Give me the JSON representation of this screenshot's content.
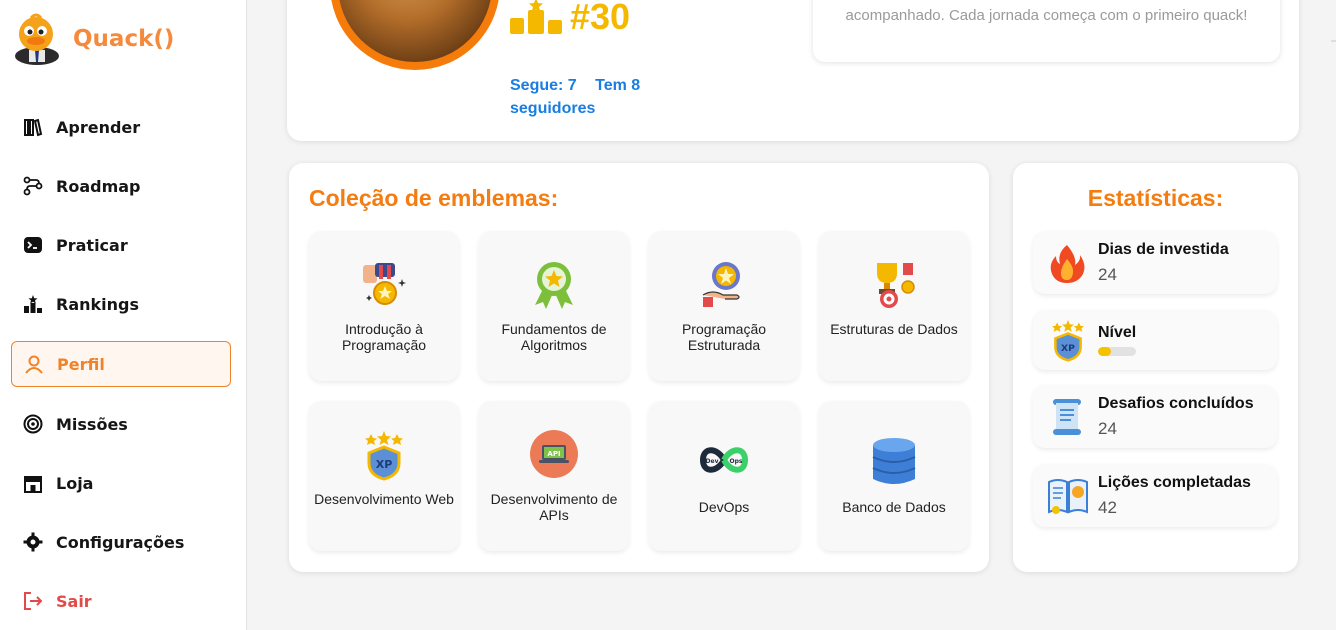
{
  "brand": {
    "name": "Quack()"
  },
  "nav": [
    {
      "label": "Aprender",
      "icon": "books-icon"
    },
    {
      "label": "Roadmap",
      "icon": "roadmap-icon"
    },
    {
      "label": "Praticar",
      "icon": "terminal-icon"
    },
    {
      "label": "Rankings",
      "icon": "podium-icon"
    },
    {
      "label": "Perfil",
      "icon": "user-icon",
      "active": true
    },
    {
      "label": "Missões",
      "icon": "target-icon"
    },
    {
      "label": "Loja",
      "icon": "store-icon"
    },
    {
      "label": "Configurações",
      "icon": "gear-icon"
    },
    {
      "label": "Sair",
      "icon": "logout-icon"
    }
  ],
  "profile": {
    "rank": "#30",
    "following": "Segue: 7",
    "followers": "Tem 8 seguidores",
    "quote": "acompanhado. Cada jornada começa com o primeiro quack!"
  },
  "badges": {
    "title": "Coleção de emblemas:",
    "items": [
      {
        "label": "Introdução à Programação",
        "icon": "medal-hand-icon"
      },
      {
        "label": "Fundamentos de Algoritmos",
        "icon": "rosette-star-icon"
      },
      {
        "label": "Programação Estruturada",
        "icon": "star-hand-icon"
      },
      {
        "label": "Estruturas de Dados",
        "icon": "trophy-target-icon"
      },
      {
        "label": "Desenvolvimento Web",
        "icon": "xp-shield-icon"
      },
      {
        "label": "Desenvolvimento de APIs",
        "icon": "api-laptop-icon"
      },
      {
        "label": "DevOps",
        "icon": "devops-infinity-icon"
      },
      {
        "label": "Banco de Dados",
        "icon": "database-icon"
      }
    ]
  },
  "stats": {
    "title": "Estatísticas:",
    "days": {
      "label": "Dias de investida",
      "value": "24",
      "icon": "fire-icon"
    },
    "level": {
      "label": "Nível",
      "progress": 0.35,
      "icon": "xp-shield-icon"
    },
    "challenges": {
      "label": "Desafios concluídos",
      "value": "24",
      "icon": "scroll-icon"
    },
    "lessons": {
      "label": "Lições completadas",
      "value": "42",
      "icon": "book-icon"
    }
  },
  "colors": {
    "accent": "#f47c10",
    "link": "#1a7de0",
    "rank": "#f5b800",
    "danger": "#e24a4a"
  }
}
